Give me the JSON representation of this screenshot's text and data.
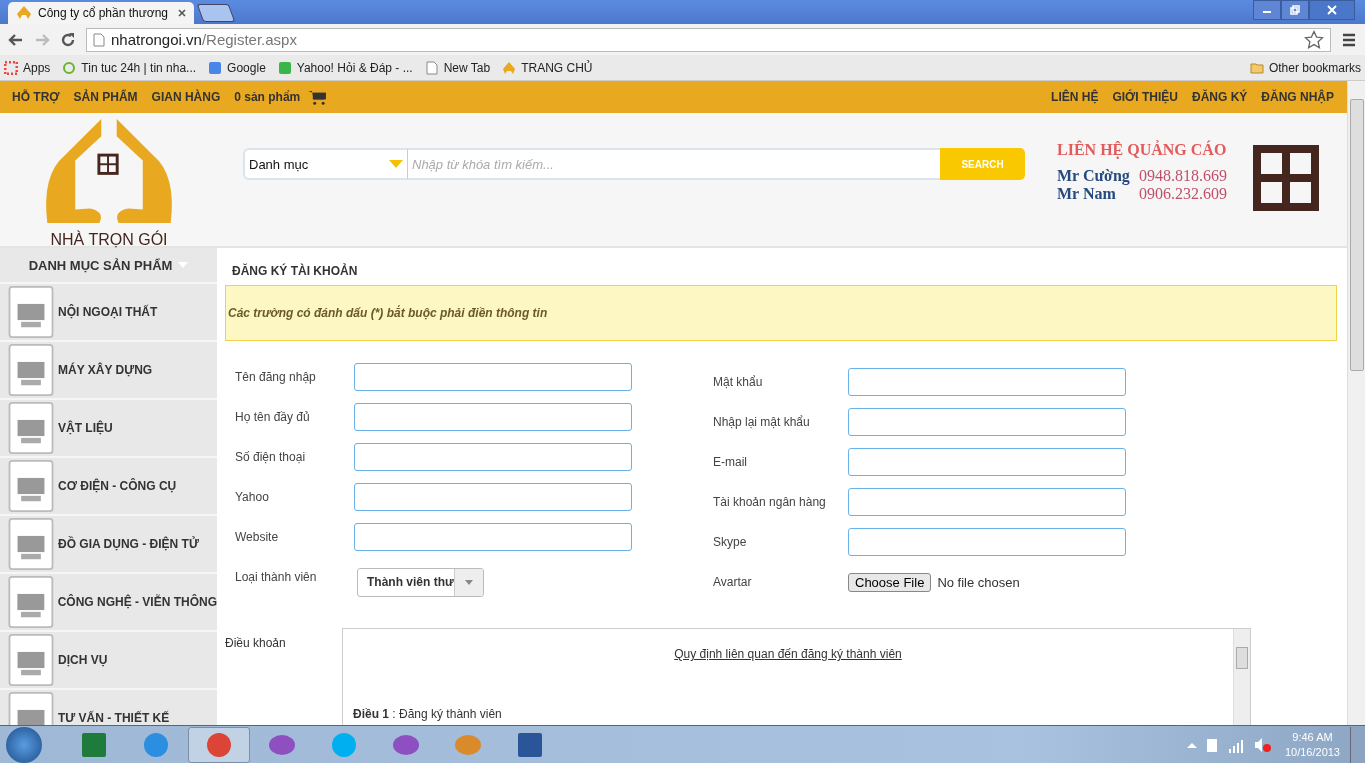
{
  "browser": {
    "tab_title": "Công ty cổ phần thương",
    "address": {
      "domain": "nhatrongoi.vn",
      "path": "/Register.aspx"
    },
    "bookmarks": [
      {
        "kind": "apps",
        "label": "Apps"
      },
      {
        "kind": "clock",
        "label": "Tin tuc 24h | tin nha..."
      },
      {
        "kind": "google",
        "label": "Google"
      },
      {
        "kind": "yahoo",
        "label": "Yahoo! Hỏi & Đáp - ..."
      },
      {
        "kind": "page",
        "label": "New Tab"
      },
      {
        "kind": "site",
        "label": "TRANG CHỦ"
      }
    ],
    "other_bookmarks": "Other bookmarks"
  },
  "site": {
    "nav_left": [
      "HỖ TRỢ",
      "SẢN PHẨM",
      "GIAN HÀNG"
    ],
    "cart": "0 sản phẩm",
    "nav_right": [
      "LIÊN HỆ",
      "GIỚI THIỆU",
      "ĐĂNG KÝ",
      "ĐĂNG NHẬP"
    ],
    "logo_text": "NHÀ TRỌN GÓI",
    "search": {
      "category": "Danh mục",
      "placeholder": "Nhập từ khóa tìm kiếm...",
      "button": "SEARCH"
    },
    "ad": {
      "title": "LIÊN HỆ QUẢNG CÁO",
      "contacts": [
        {
          "name": "Mr Cường",
          "phone": "0948.818.669"
        },
        {
          "name": "Mr Nam",
          "phone": "0906.232.609"
        }
      ]
    },
    "sidebar": {
      "title": "DANH MỤC SẢN PHẨM",
      "items": [
        {
          "label": "NỘI NGOẠI THẤT"
        },
        {
          "label": "MÁY XÂY DỰNG"
        },
        {
          "label": "VẬT LIỆU"
        },
        {
          "label": "CƠ ĐIỆN - CÔNG CỤ"
        },
        {
          "label": "ĐỒ GIA DỤNG - ĐIỆN TỬ"
        },
        {
          "label": "CÔNG NGHỆ - VIỄN THÔNG"
        },
        {
          "label": "DỊCH VỤ"
        },
        {
          "label": "TƯ VẤN - THIẾT KẾ"
        }
      ]
    },
    "form": {
      "title": "ĐĂNG KÝ TÀI KHOẢN",
      "notice": "Các trường có đánh dấu (*) bắt buộc phải điền thông tin",
      "left_fields": [
        {
          "label": "Tên đăng nhập"
        },
        {
          "label": "Họ tên đầy đủ"
        },
        {
          "label": "Số điện thoại"
        },
        {
          "label": "Yahoo"
        },
        {
          "label": "Website"
        }
      ],
      "member_type": {
        "label": "Loại thành viên",
        "value": "Thành viên thư"
      },
      "right_fields": [
        {
          "label": "Mật khẩu"
        },
        {
          "label": "Nhập lại mật khẩu"
        },
        {
          "label": "E-mail"
        },
        {
          "label": "Tài khoản ngân hàng"
        },
        {
          "label": "Skype"
        }
      ],
      "avatar": {
        "label": "Avartar",
        "button": "Choose File",
        "status": "No file chosen"
      }
    },
    "terms": {
      "label": "Điều khoản",
      "link": "Quy định liên quan đến đăng ký thành viên",
      "article": "**Điều 1** : Đăng ký thành viên"
    }
  },
  "taskbar": {
    "apps": [
      {
        "kind": "excel",
        "selected": false
      },
      {
        "kind": "ie",
        "selected": false
      },
      {
        "kind": "chrome",
        "selected": true
      },
      {
        "kind": "messenger",
        "selected": false
      },
      {
        "kind": "skype",
        "selected": false
      },
      {
        "kind": "messenger",
        "selected": false
      },
      {
        "kind": "paint",
        "selected": false
      },
      {
        "kind": "word",
        "selected": false
      }
    ],
    "time": "9:46 AM",
    "date": "10/16/2013"
  }
}
